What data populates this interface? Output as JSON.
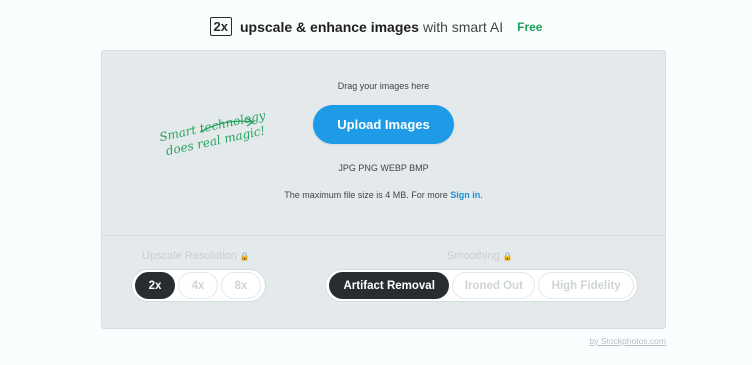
{
  "header": {
    "badge": "2x",
    "title_bold": "upscale & enhance images",
    "title_light": "with smart AI",
    "free_label": "Free"
  },
  "upload": {
    "drag_text": "Drag your images here",
    "button_label": "Upload Images",
    "formats": "JPG PNG WEBP BMP",
    "max_size_text": "The maximum file size is 4 MB. For more",
    "signin_link": "Sign in",
    "signin_suffix": "."
  },
  "tagline": {
    "line1": "Smart technology",
    "line2": "does real magic!"
  },
  "options": {
    "resolution": {
      "label": "Upscale Resolution",
      "lock_icon": "lock-icon",
      "choices": [
        "2x",
        "4x",
        "8x"
      ],
      "selected": "2x"
    },
    "smoothing": {
      "label": "Smoothing",
      "lock_icon": "lock-icon",
      "choices": [
        "Artifact Removal",
        "Ironed Out",
        "High Fidelity"
      ],
      "selected": "Artifact Removal"
    }
  },
  "footer": {
    "credit": "by Stockphotos.com"
  },
  "colors": {
    "accent": "#1e9be6",
    "free_green": "#1ea25a",
    "script_green": "#27a35e",
    "selected_pill": "#2a2d30"
  }
}
